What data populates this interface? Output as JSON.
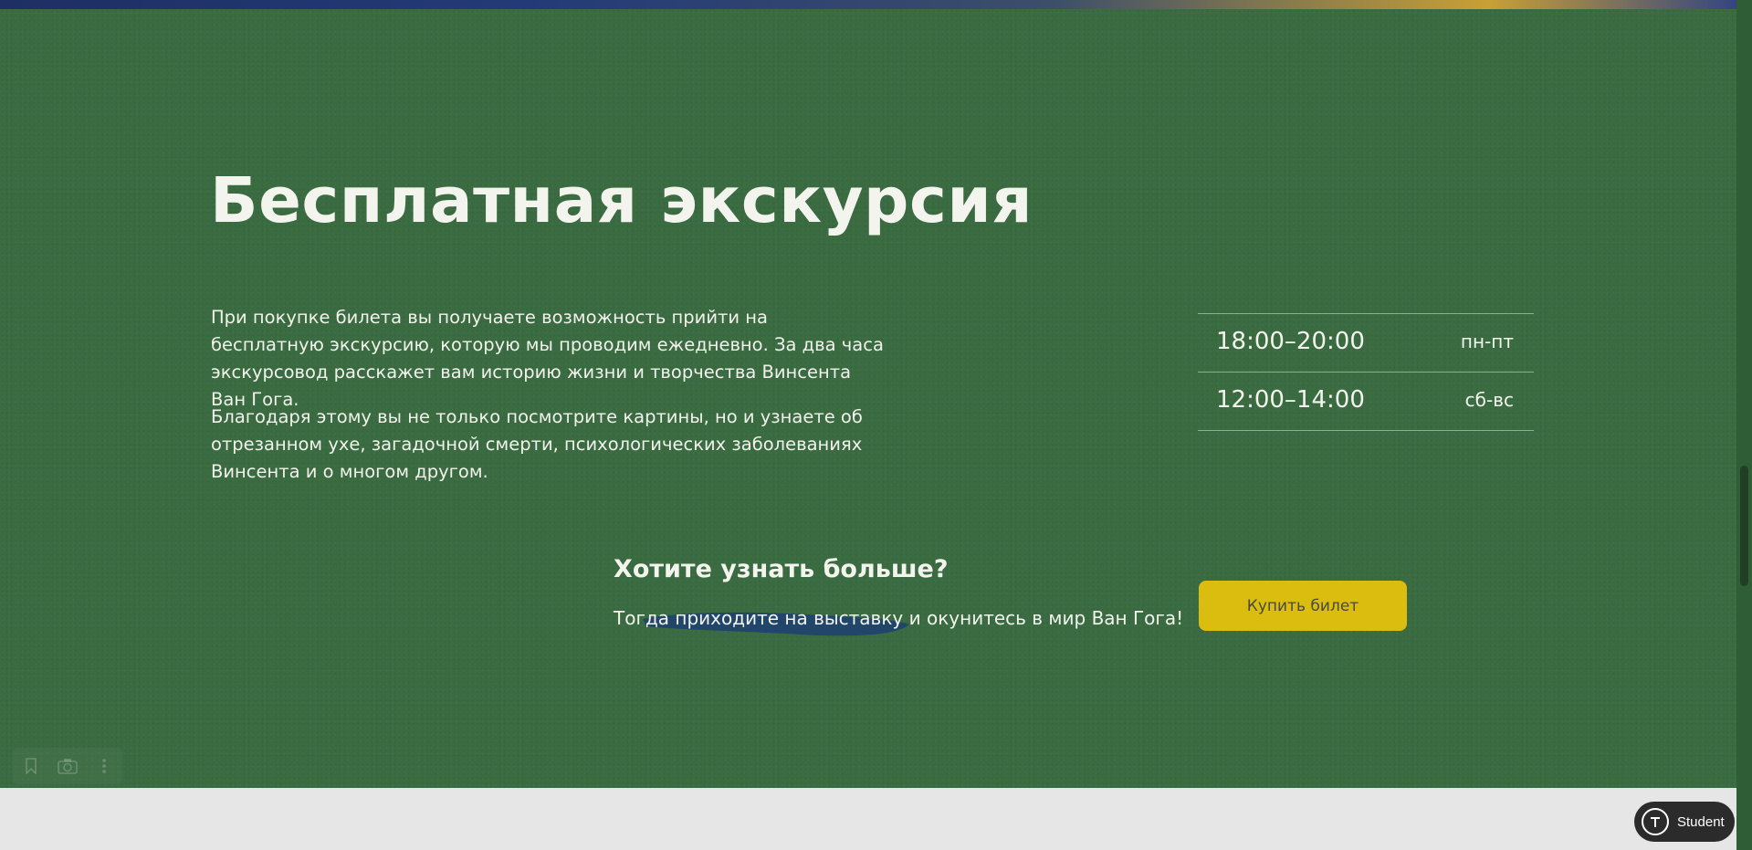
{
  "section": {
    "title": "Бесплатная экскурсия",
    "paragraph1": "При покупке билета вы получаете возможность прийти на бесплатную экскурсию, которую мы проводим ежедневно. За два часа экскурсовод расскажет вам историю жизни и творчества Винсента Ван Гога.",
    "paragraph2": "Благодаря этому вы не только посмотрите картины, но и узнаете об отрезанном ухе, загадочной смерти, психологических заболеваниях Винсента и о многом другом."
  },
  "schedule": [
    {
      "time": "18:00–20:00",
      "days": "пн-пт"
    },
    {
      "time": "12:00–14:00",
      "days": "сб-вс"
    }
  ],
  "cta": {
    "title": "Хотите узнать больше?",
    "text": "Тогда приходите на выставку и окунитесь в мир Ван Гога!",
    "button_label": "Купить билет"
  },
  "badge": {
    "label": "Student",
    "icon": "t-logo-icon"
  },
  "overlay_tools": {
    "icons": [
      "bookmark-icon",
      "camera-icon",
      "more-vertical-icon"
    ]
  },
  "colors": {
    "section_background": "#3a6b41",
    "button": "#dbbd10",
    "text": "#f4f4ef",
    "highlight_stroke": "#1f3f72"
  }
}
